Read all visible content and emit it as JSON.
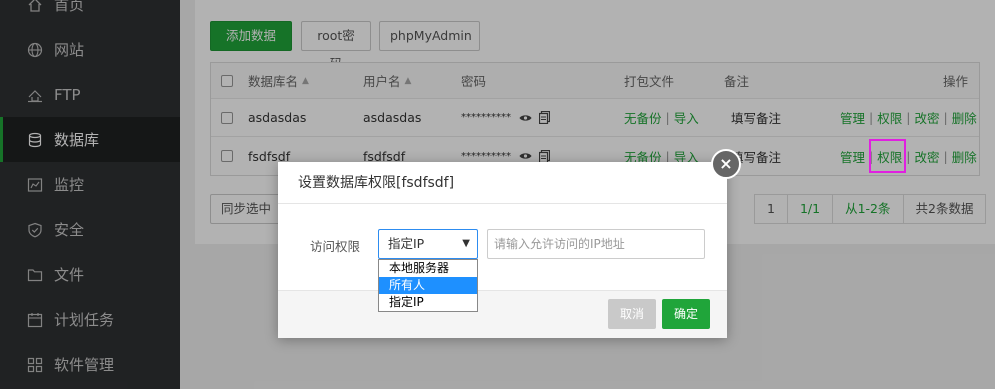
{
  "sidebar": {
    "items": [
      {
        "label": "首页",
        "icon": "home-icon",
        "active": false
      },
      {
        "label": "网站",
        "icon": "globe-icon",
        "active": false
      },
      {
        "label": "FTP",
        "icon": "ftp-icon",
        "active": false
      },
      {
        "label": "数据库",
        "icon": "database-icon",
        "active": true
      },
      {
        "label": "监控",
        "icon": "monitor-icon",
        "active": false
      },
      {
        "label": "安全",
        "icon": "shield-icon",
        "active": false
      },
      {
        "label": "文件",
        "icon": "folder-icon",
        "active": false
      },
      {
        "label": "计划任务",
        "icon": "calendar-icon",
        "active": false
      },
      {
        "label": "软件管理",
        "icon": "apps-icon",
        "active": false
      }
    ]
  },
  "toolbar": {
    "add_db": "添加数据库",
    "root_pwd": "root密码",
    "phpmyadmin": "phpMyAdmin"
  },
  "table": {
    "headers": {
      "dbname": "数据库名",
      "username": "用户名",
      "password": "密码",
      "backup": "打包文件",
      "note": "备注",
      "actions": "操作"
    },
    "rows": [
      {
        "dbname": "asdasdas",
        "username": "asdasdas",
        "password": "**********",
        "backup_none": "无备份",
        "import": "导入",
        "note": "填写备注",
        "manage": "管理",
        "perm": "权限",
        "change_pwd": "改密",
        "delete": "删除"
      },
      {
        "dbname": "fsdfsdf",
        "username": "fsdfsdf",
        "password": "**********",
        "backup_none": "无备份",
        "import": "导入",
        "note": "填写备注",
        "manage": "管理",
        "perm": "权限",
        "change_pwd": "改密",
        "delete": "删除"
      }
    ]
  },
  "bottom": {
    "sync_selected": "同步选中",
    "pager": {
      "page": "1",
      "pages": "1/1",
      "range": "从1-2条",
      "total": "共2条数据"
    }
  },
  "modal": {
    "title": "设置数据库权限[fsdfsdf]",
    "close": "×",
    "label": "访问权限",
    "select_value": "指定IP",
    "ip_placeholder": "请输入允许访问的IP地址",
    "options": [
      "本地服务器",
      "所有人",
      "指定IP"
    ],
    "highlighted_option": "所有人",
    "cancel": "取消",
    "ok": "确定"
  },
  "colors": {
    "accent": "#20a53a",
    "sidebar_bg": "#2f3133",
    "highlight_box": "#e020e0",
    "dropdown_selected": "#1e90ff"
  }
}
